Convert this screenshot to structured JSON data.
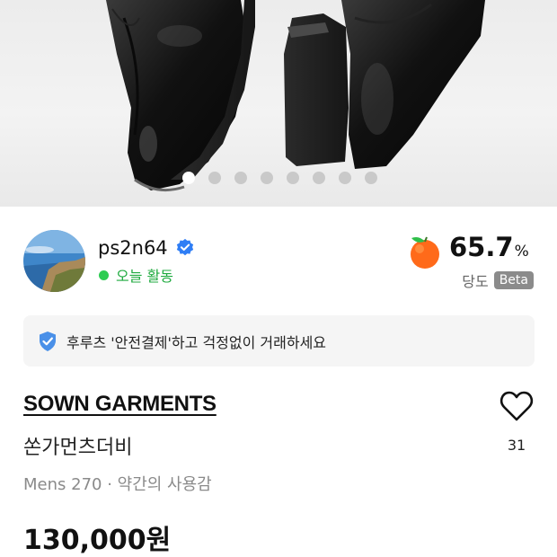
{
  "gallery": {
    "slide_count": 8,
    "active_index": 0,
    "image_icon": "boot-photo"
  },
  "seller": {
    "username": "ps2n64",
    "verified_icon": "verified-badge-icon",
    "activity": "오늘 활동",
    "activity_color": "#2ecc52",
    "score": "65.7",
    "score_unit": "%",
    "score_label": "당도",
    "beta_label": "Beta",
    "score_icon": "orange-icon"
  },
  "safe_payment": {
    "text": "후루츠 '안전결제'하고 걱정없이 거래하세요",
    "icon": "shield-icon"
  },
  "product": {
    "brand": "SOWN GARMENTS",
    "name": "쏜가먼츠더비",
    "meta": "Mens 270 · 약간의 사용감",
    "price": "130,000원"
  },
  "like": {
    "count": "31",
    "icon": "heart-icon"
  }
}
